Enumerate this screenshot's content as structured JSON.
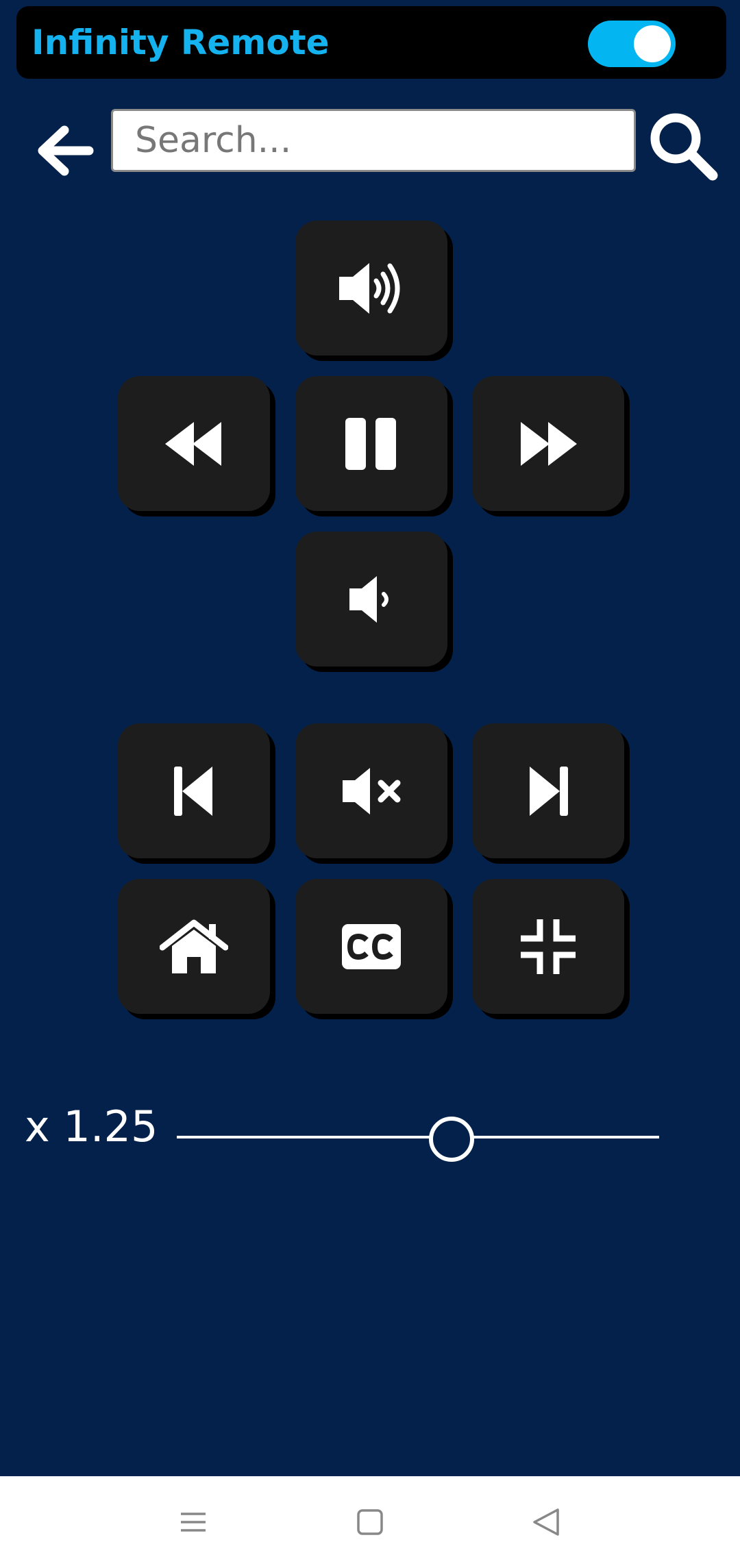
{
  "app": {
    "title": "Infinity Remote",
    "toggle_on": true,
    "accent_color": "#15b2f0",
    "background_color": "#03214a"
  },
  "search": {
    "placeholder": "Search...",
    "value": ""
  },
  "icons": {
    "back": "arrow-left-icon",
    "search": "magnifier-icon",
    "volume_up": "volume-high-icon",
    "rewind": "rewind-icon",
    "pause": "pause-icon",
    "fast_forward": "fast-forward-icon",
    "volume_down": "volume-low-icon",
    "skip_previous": "skip-back-icon",
    "mute": "volume-mute-icon",
    "skip_next": "skip-forward-icon",
    "home": "home-icon",
    "captions": "closed-captions-icon",
    "exit_fullscreen": "compress-icon"
  },
  "playback": {
    "speed_label": "x 1.25",
    "speed_fraction": 0.565
  },
  "navbar": {
    "recents": "menu-icon",
    "home": "square-icon",
    "back": "triangle-back-icon"
  }
}
